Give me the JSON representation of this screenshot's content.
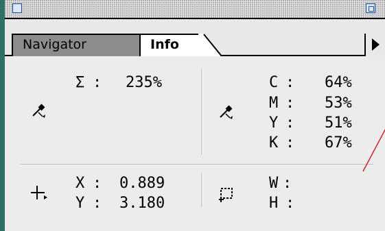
{
  "window": {
    "tabs": [
      {
        "label": "Navigator",
        "active": false
      },
      {
        "label": "Info",
        "active": true
      }
    ]
  },
  "icons": {
    "close_box": "close-box-icon",
    "zoom_box": "zoom-box-icon",
    "palette_menu": "triangle-right-icon",
    "eyedropper": "eyedropper-icon",
    "crosshair": "crosshair-icon",
    "marquee": "marquee-selection-icon"
  },
  "info": {
    "total_ink": {
      "label": "Σ",
      "sep": ":",
      "value": "235%"
    },
    "cmyk": [
      {
        "label": "C",
        "sep": ":",
        "value": "64%"
      },
      {
        "label": "M",
        "sep": ":",
        "value": "53%"
      },
      {
        "label": "Y",
        "sep": ":",
        "value": "51%"
      },
      {
        "label": "K",
        "sep": ":",
        "value": "67%"
      }
    ],
    "position": [
      {
        "label": "X",
        "sep": ":",
        "value": "0.889"
      },
      {
        "label": "Y",
        "sep": ":",
        "value": "3.180"
      }
    ],
    "size": [
      {
        "label": "W",
        "sep": ":",
        "value": ""
      },
      {
        "label": "H",
        "sep": ":",
        "value": ""
      }
    ]
  },
  "colors": {
    "window_edge": "#2f6f65",
    "active_tab": "#ffffff",
    "inactive_tab": "#8d8d8d",
    "panel_bg": "#ececec",
    "callout_line": "#cc2233",
    "title_button": "#1b4fa0"
  }
}
